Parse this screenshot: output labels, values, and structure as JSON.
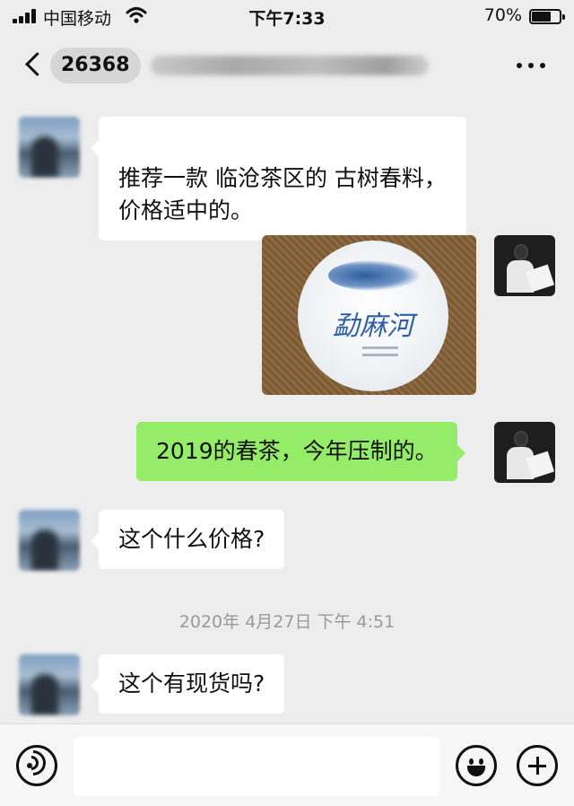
{
  "status_bar": {
    "carrier": "中国移动",
    "time": "下午7:33",
    "battery_text": "70%",
    "battery_level": 0.7
  },
  "header": {
    "title": "26368",
    "icons": [
      "back-icon",
      "more-icon"
    ]
  },
  "messages": [
    {
      "side": "left",
      "type": "text",
      "text": "推荐一款 临沧茶区的 古树春料，\n价格适中的。"
    },
    {
      "side": "right",
      "type": "image",
      "brand_text": "勐麻河"
    },
    {
      "side": "right",
      "type": "text",
      "text": "2019的春茶，今年压制的。"
    },
    {
      "side": "left",
      "type": "text",
      "text": "这个什么价格?"
    },
    {
      "side": "left",
      "type": "text",
      "text": "这个有现货吗?"
    }
  ],
  "timestamp": "2020年 4月27日 下午 4:51",
  "input_bar": {
    "value": "",
    "icons": [
      "voice-icon",
      "emoji-icon",
      "plus-icon"
    ]
  },
  "colors": {
    "background": "#ededed",
    "incoming_bubble": "#ffffff",
    "outgoing_bubble": "#95ec69",
    "timestamp": "#9a9a9a"
  }
}
